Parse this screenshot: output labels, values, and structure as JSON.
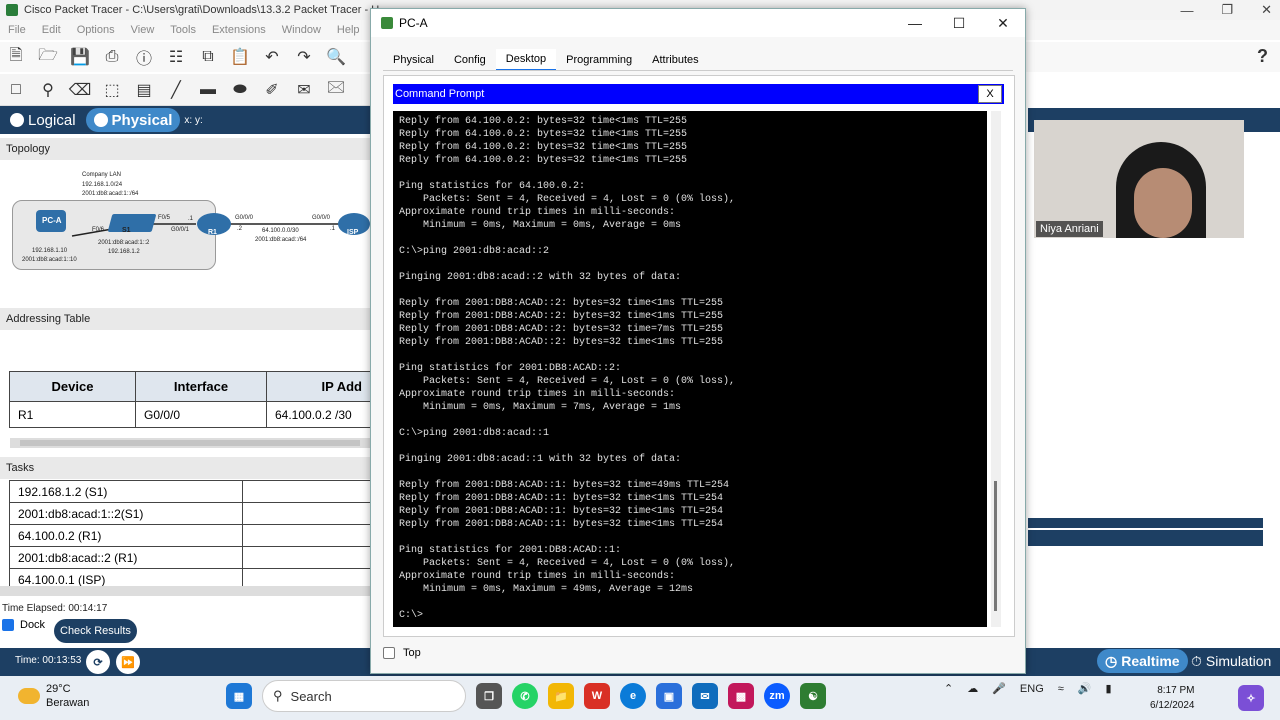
{
  "app": {
    "title": "Cisco Packet Tracer - C:\\Users\\grati\\Downloads\\13.3.2 Packet Tracer - U",
    "menu": [
      "File",
      "Edit",
      "Options",
      "View",
      "Tools",
      "Extensions",
      "Window",
      "Help"
    ],
    "help_label": "?",
    "modes": {
      "logical": "Logical",
      "physical": "Physical",
      "xy": "x: y:"
    }
  },
  "topology": {
    "header": "Topology",
    "company_lan": "Company LAN",
    "lan_v4": "192.168.1.0/24",
    "lan_v6": "2001:db8:acad:1::/64",
    "pca": "PC-A",
    "s1": "S1",
    "r1": "R1",
    "isp": "ISP",
    "f05": "F0/5",
    "f06": "F0/6",
    "g001": "G0/0/1",
    "g000a": "G0/0/0",
    "g000b": "G0/0/0",
    "dot1a": ".1",
    "dot1b": ".1",
    "dot2": ".2",
    "wan_v4": "64.100.0.0/30",
    "wan_v6": "2001:db8:acad::/64",
    "pca_v4": "192.168.1.10",
    "pca_v6": "2001:db8:acad:1::10",
    "s1_v6": "2001:db8:acad:1::2",
    "s1_v4": "192.168.1.2"
  },
  "addressing": {
    "header": "Addressing Table",
    "columns": [
      "Device",
      "Interface",
      "IP Add"
    ],
    "rows": [
      {
        "device": "R1",
        "interface": "G0/0/0",
        "ip": "64.100.0.2 /30"
      }
    ]
  },
  "tasks": {
    "header": "Tasks",
    "rows": [
      "192.168.1.2 (S1)",
      "2001:db8:acad:1::2(S1)",
      "64.100.0.2 (R1)",
      "2001:db8:acad::2 (R1)",
      "64.100.0.1 (ISP)"
    ]
  },
  "status": {
    "time_elapsed": "Time Elapsed: 00:14:17",
    "dock": "Dock",
    "check_results": "Check Results",
    "time": "Time: 00:13:53",
    "realtime": "Realtime",
    "simulation": "Simulation"
  },
  "pca_window": {
    "title": "PC-A",
    "tabs": [
      "Physical",
      "Config",
      "Desktop",
      "Programming",
      "Attributes"
    ],
    "active_tab": "Desktop",
    "cmd_title": "Command Prompt",
    "cmd_close": "X",
    "top_label": "Top",
    "terminal_lines": [
      "Reply from 64.100.0.2: bytes=32 time<1ms TTL=255",
      "Reply from 64.100.0.2: bytes=32 time<1ms TTL=255",
      "Reply from 64.100.0.2: bytes=32 time<1ms TTL=255",
      "Reply from 64.100.0.2: bytes=32 time<1ms TTL=255",
      "",
      "Ping statistics for 64.100.0.2:",
      "    Packets: Sent = 4, Received = 4, Lost = 0 (0% loss),",
      "Approximate round trip times in milli-seconds:",
      "    Minimum = 0ms, Maximum = 0ms, Average = 0ms",
      "",
      "C:\\>ping 2001:db8:acad::2",
      "",
      "Pinging 2001:db8:acad::2 with 32 bytes of data:",
      "",
      "Reply from 2001:DB8:ACAD::2: bytes=32 time<1ms TTL=255",
      "Reply from 2001:DB8:ACAD::2: bytes=32 time<1ms TTL=255",
      "Reply from 2001:DB8:ACAD::2: bytes=32 time=7ms TTL=255",
      "Reply from 2001:DB8:ACAD::2: bytes=32 time<1ms TTL=255",
      "",
      "Ping statistics for 2001:DB8:ACAD::2:",
      "    Packets: Sent = 4, Received = 4, Lost = 0 (0% loss),",
      "Approximate round trip times in milli-seconds:",
      "    Minimum = 0ms, Maximum = 7ms, Average = 1ms",
      "",
      "C:\\>ping 2001:db8:acad::1",
      "",
      "Pinging 2001:db8:acad::1 with 32 bytes of data:",
      "",
      "Reply from 2001:DB8:ACAD::1: bytes=32 time=49ms TTL=254",
      "Reply from 2001:DB8:ACAD::1: bytes=32 time<1ms TTL=254",
      "Reply from 2001:DB8:ACAD::1: bytes=32 time<1ms TTL=254",
      "Reply from 2001:DB8:ACAD::1: bytes=32 time<1ms TTL=254",
      "",
      "Ping statistics for 2001:DB8:ACAD::1:",
      "    Packets: Sent = 4, Received = 4, Lost = 0 (0% loss),",
      "Approximate round trip times in milli-seconds:",
      "    Minimum = 0ms, Maximum = 49ms, Average = 12ms",
      "",
      "C:\\>"
    ]
  },
  "webcam": {
    "name": "Niya Anriani"
  },
  "taskbar": {
    "temp": "29°C",
    "weather": "Berawan",
    "search": "Search",
    "lang": "ENG",
    "time": "8:17 PM",
    "date": "6/12/2024"
  },
  "colors": {
    "pt_navy": "#1d3f63",
    "pt_blue": "#3f89c9",
    "cmd_header": "#0000ff"
  }
}
